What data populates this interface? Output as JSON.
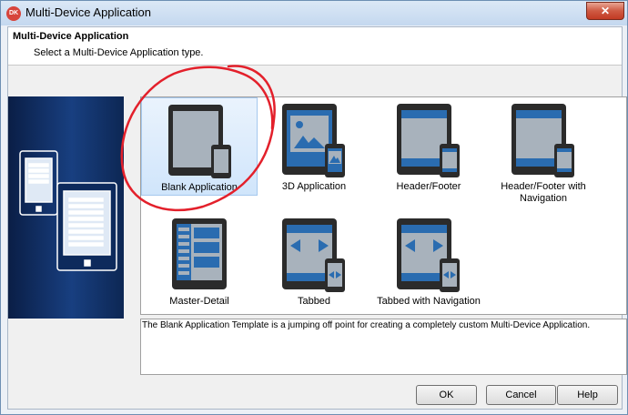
{
  "window": {
    "title": "Multi-Device Application",
    "icon_text": "DK",
    "close_glyph": "✕"
  },
  "header": {
    "title": "Multi-Device Application",
    "subtitle": "Select a Multi-Device Application type."
  },
  "templates": [
    {
      "label": "Blank Application",
      "icon": "blank-template-icon",
      "selected": true
    },
    {
      "label": "3D Application",
      "icon": "3d-template-icon",
      "selected": false
    },
    {
      "label": "Header/Footer",
      "icon": "header-footer-template-icon",
      "selected": false
    },
    {
      "label": "Header/Footer with Navigation",
      "icon": "header-footer-navigation-template-icon",
      "selected": false
    },
    {
      "label": "Master-Detail",
      "icon": "master-detail-template-icon",
      "selected": false
    },
    {
      "label": "Tabbed",
      "icon": "tabbed-template-icon",
      "selected": false
    },
    {
      "label": "Tabbed with Navigation",
      "icon": "tabbed-navigation-template-icon",
      "selected": false
    }
  ],
  "description": "The Blank Application Template is a jumping off point for creating a completely custom Multi-Device Application.",
  "buttons": {
    "ok": "OK",
    "cancel": "Cancel",
    "help": "Help"
  },
  "colors": {
    "selection": "#d0e5fb",
    "device_frame": "#2b2b2b",
    "template_accent": "#2a6cb0",
    "annotation": "#e3202b"
  }
}
